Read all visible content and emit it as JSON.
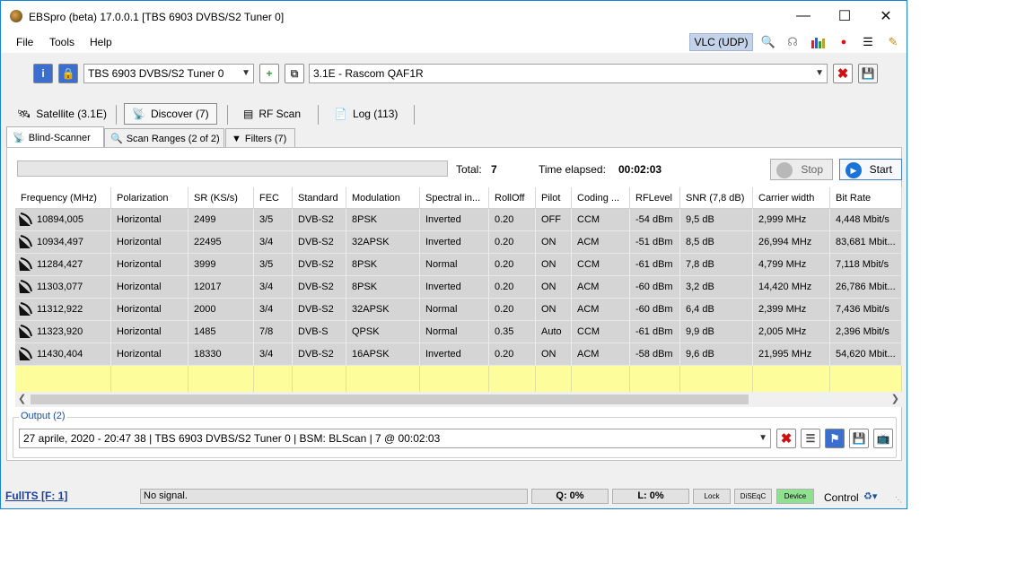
{
  "window": {
    "title": "EBSpro (beta) 17.0.0.1 [TBS 6903 DVBS/S2 Tuner 0]"
  },
  "menu": {
    "items": [
      "File",
      "Tools",
      "Help"
    ]
  },
  "toolbar": {
    "vlc_label": "VLC (UDP)",
    "tuner": "TBS 6903 DVBS/S2 Tuner 0",
    "satellite": "3.1E - Rascom QAF1R"
  },
  "tabs": {
    "satellite": "Satellite (3.1E)",
    "discover": "Discover (7)",
    "rfscan": "RF Scan",
    "log": "Log (113)"
  },
  "subtabs": {
    "blindscanner": "Blind-Scanner",
    "scanranges": "Scan Ranges (2 of 2)",
    "filters": "Filters (7)"
  },
  "scan": {
    "total_label": "Total:",
    "total_value": "7",
    "elapsed_label": "Time elapsed:",
    "elapsed_value": "00:02:03",
    "stop_label": "Stop",
    "start_label": "Start"
  },
  "table": {
    "columns": [
      "Frequency (MHz)",
      "Polarization",
      "SR (KS/s)",
      "FEC",
      "Standard",
      "Modulation",
      "Spectral in...",
      "RollOff",
      "Pilot",
      "Coding ...",
      "RFLevel",
      "SNR (7,8 dB)",
      "Carrier width",
      "Bit Rate"
    ],
    "rows": [
      [
        "10894,005",
        "Horizontal",
        "2499",
        "3/5",
        "DVB-S2",
        "8PSK",
        "Inverted",
        "0.20",
        "OFF",
        "CCM",
        "-54 dBm",
        "9,5 dB",
        "2,999 MHz",
        "4,448 Mbit/s"
      ],
      [
        "10934,497",
        "Horizontal",
        "22495",
        "3/4",
        "DVB-S2",
        "32APSK",
        "Inverted",
        "0.20",
        "ON",
        "ACM",
        "-51 dBm",
        "8,5 dB",
        "26,994 MHz",
        "83,681 Mbit..."
      ],
      [
        "11284,427",
        "Horizontal",
        "3999",
        "3/5",
        "DVB-S2",
        "8PSK",
        "Normal",
        "0.20",
        "ON",
        "CCM",
        "-61 dBm",
        "7,8 dB",
        "4,799 MHz",
        "7,118 Mbit/s"
      ],
      [
        "11303,077",
        "Horizontal",
        "12017",
        "3/4",
        "DVB-S2",
        "8PSK",
        "Inverted",
        "0.20",
        "ON",
        "ACM",
        "-60 dBm",
        "3,2 dB",
        "14,420 MHz",
        "26,786 Mbit..."
      ],
      [
        "11312,922",
        "Horizontal",
        "2000",
        "3/4",
        "DVB-S2",
        "32APSK",
        "Normal",
        "0.20",
        "ON",
        "ACM",
        "-60 dBm",
        "6,4 dB",
        "2,399 MHz",
        "7,436 Mbit/s"
      ],
      [
        "11323,920",
        "Horizontal",
        "1485",
        "7/8",
        "DVB-S",
        "QPSK",
        "Normal",
        "0.35",
        "Auto",
        "CCM",
        "-61 dBm",
        "9,9 dB",
        "2,005 MHz",
        "2,396 Mbit/s"
      ],
      [
        "11430,404",
        "Horizontal",
        "18330",
        "3/4",
        "DVB-S2",
        "16APSK",
        "Inverted",
        "0.20",
        "ON",
        "ACM",
        "-58 dBm",
        "9,6 dB",
        "21,995 MHz",
        "54,620 Mbit..."
      ]
    ]
  },
  "output": {
    "legend": "Output (2)",
    "value": "27 aprile, 2020 - 20:47 38 | TBS 6903 DVBS/S2 Tuner 0 | BSM: BLScan | 7 @ 00:02:03"
  },
  "status": {
    "fullts": "FullTS [F: 1]",
    "signal": "No signal.",
    "q": "Q: 0%",
    "l": "L: 0%",
    "lock": "Lock",
    "diseqc": "DiSEqC",
    "device": "Device",
    "control": "Control"
  },
  "colors": {
    "accent": "#1883d7",
    "row_bg": "#d5d5d5",
    "empty_row": "#fdfd9c",
    "device_green": "#8fe08f"
  }
}
